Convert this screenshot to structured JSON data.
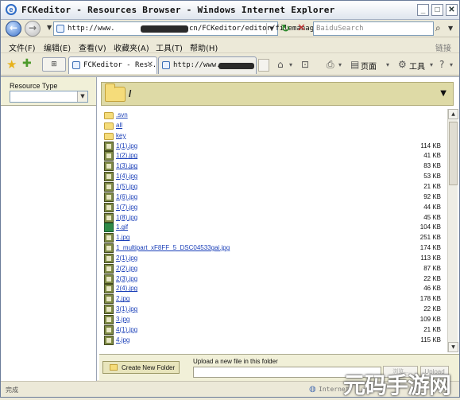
{
  "window": {
    "title": "FCKeditor - Resources Browser - Windows Internet Explorer",
    "minimize_label": "_",
    "maximize_label": "□",
    "close_label": "✕"
  },
  "addressbar": {
    "back_glyph": "←",
    "forward_glyph": "→",
    "address_prefix": "http://www.",
    "address_suffix": "cn/FCKeditor/editor/filemanager/b",
    "search_placeholder": "BaiduSearch"
  },
  "menubar": {
    "items": [
      "文件(F)",
      "编辑(E)",
      "查看(V)",
      "收藏夹(A)",
      "工具(T)",
      "帮助(H)"
    ],
    "links_label": "链接"
  },
  "tabbar": {
    "quicktabs_glyph": "⊞",
    "tabs": [
      {
        "label": "FCKeditor - Res..."
      },
      {
        "label": "http://www."
      }
    ],
    "page_label": "页面",
    "tools_label": "工具"
  },
  "left_panel": {
    "resource_type_label": "Resource Type",
    "resource_type_value": ""
  },
  "folder_header": {
    "path": "/"
  },
  "files": [
    {
      "kind": "folder",
      "name": ".svn",
      "size": ""
    },
    {
      "kind": "folder",
      "name": "all",
      "size": ""
    },
    {
      "kind": "folder",
      "name": "key",
      "size": ""
    },
    {
      "kind": "img",
      "name": "1(1).jpg",
      "size": "114 KB"
    },
    {
      "kind": "img",
      "name": "1(2).jpg",
      "size": "41 KB"
    },
    {
      "kind": "img",
      "name": "1(3).jpg",
      "size": "83 KB"
    },
    {
      "kind": "img",
      "name": "1(4).jpg",
      "size": "53 KB"
    },
    {
      "kind": "img",
      "name": "1(5).jpg",
      "size": "21 KB"
    },
    {
      "kind": "img",
      "name": "1(6).jpg",
      "size": "92 KB"
    },
    {
      "kind": "img",
      "name": "1(7).jpg",
      "size": "44 KB"
    },
    {
      "kind": "img",
      "name": "1(8).jpg",
      "size": "45 KB"
    },
    {
      "kind": "gif",
      "name": "1.gif",
      "size": "104 KB"
    },
    {
      "kind": "img",
      "name": "1.jpg",
      "size": "251 KB"
    },
    {
      "kind": "img",
      "name": "1_multipart_xF8FF_5_DSC04533gai.jpg",
      "size": "174 KB"
    },
    {
      "kind": "img",
      "name": "2(1).jpg",
      "size": "113 KB"
    },
    {
      "kind": "img",
      "name": "2(2).jpg",
      "size": "87 KB"
    },
    {
      "kind": "img",
      "name": "2(3).jpg",
      "size": "22 KB"
    },
    {
      "kind": "img",
      "name": "2(4).jpg",
      "size": "46 KB"
    },
    {
      "kind": "img",
      "name": "2.jpg",
      "size": "178 KB"
    },
    {
      "kind": "img",
      "name": "3(1).jpg",
      "size": "22 KB"
    },
    {
      "kind": "img",
      "name": "3.jpg",
      "size": "109 KB"
    },
    {
      "kind": "img",
      "name": "4(1).jpg",
      "size": "21 KB"
    },
    {
      "kind": "img",
      "name": "4.jpg",
      "size": "115 KB"
    }
  ],
  "bottom": {
    "create_folder_label": "Create New Folder",
    "upload_label": "Upload a new file in this folder",
    "browse_label": "浏览...",
    "upload_button_label": "Upload"
  },
  "statusbar": {
    "status": "完成",
    "zone": "Internet"
  },
  "watermark": "元码手游网"
}
